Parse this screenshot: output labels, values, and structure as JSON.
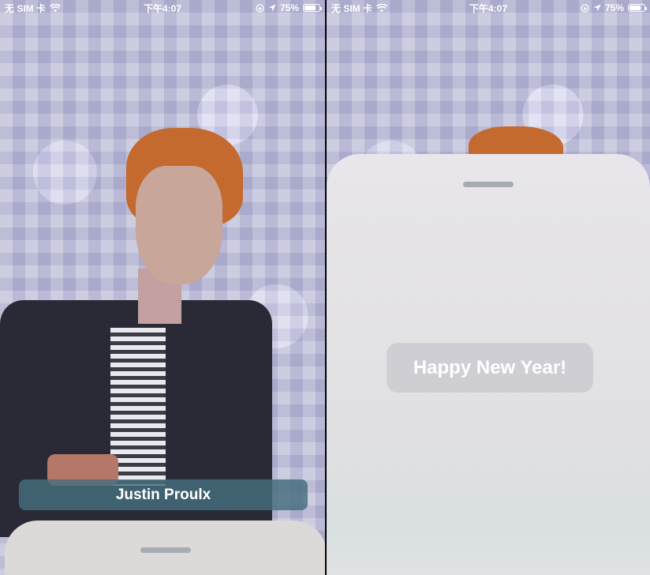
{
  "status_bar": {
    "carrier": "无 SIM 卡",
    "time": "下午4:07",
    "battery_percent": "75%",
    "battery_level": 0.75,
    "icons": [
      "wifi-icon",
      "orientation-lock-icon",
      "location-arrow-icon",
      "battery-icon"
    ]
  },
  "left_screen": {
    "contact_name": "Justin Proulx"
  },
  "right_screen": {
    "message": "Happy New Year!"
  },
  "colors": {
    "name_pill": "#466e7d",
    "sheet": "#e3e2e4",
    "grabber": "#a8acb2"
  }
}
